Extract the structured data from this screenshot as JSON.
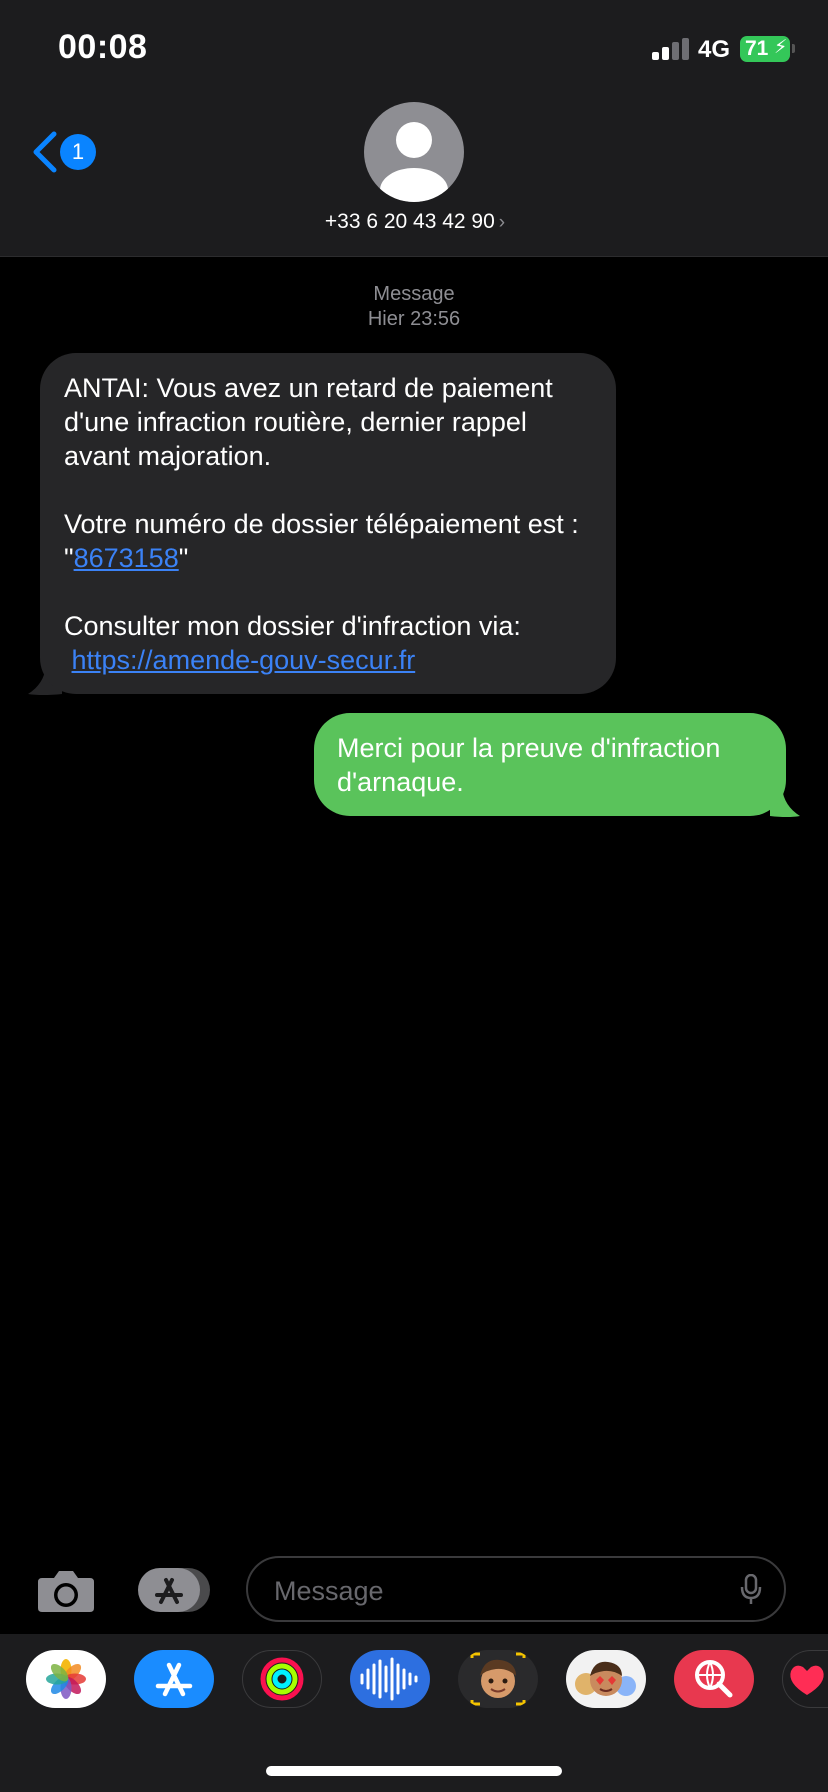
{
  "status_bar": {
    "time": "00:08",
    "network": "4G",
    "battery": "71"
  },
  "header": {
    "back_count": "1",
    "contact": "+33 6 20 43 42 90"
  },
  "conversation": {
    "service": "Message",
    "timestamp": "Hier 23:56",
    "incoming": {
      "line1": "ANTAI: Vous avez un retard de paiement d'une infraction routière, dernier rappel avant majoration.",
      "line2_prefix": "Votre numéro de dossier télépaiement est : \"",
      "dossier_number": "8673158",
      "line2_suffix": "\"",
      "line3": "Consulter mon dossier d'infraction via:",
      "link": "https://amende-gouv-secur.fr"
    },
    "outgoing": {
      "text": "Merci pour la preuve d'infraction d'arnaque."
    }
  },
  "composer": {
    "placeholder": "Message"
  },
  "app_tray": [
    "photos-icon",
    "app-store-icon",
    "activity-icon",
    "audio-message-icon",
    "memoji-icon",
    "memoji-stickers-icon",
    "web-search-icon",
    "digital-touch-icon"
  ],
  "colors": {
    "accent": "#0a84ff",
    "outgoing_bubble": "#5ac35b",
    "incoming_bubble": "#262628",
    "link": "#3b82f6"
  }
}
